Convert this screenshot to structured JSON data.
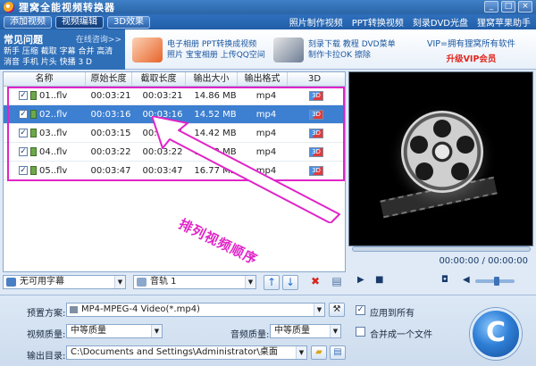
{
  "window": {
    "title": "狸窝全能视频转换器",
    "controls": [
      "_",
      "□",
      "×"
    ]
  },
  "menu": {
    "tabs": [
      "添加视频",
      "视频编辑",
      "3D效果"
    ],
    "active_tab": "视频编辑",
    "links": [
      "照片制作视频",
      "PPT转换视频",
      "刻录DVD光盘",
      "狸窝苹果助手"
    ]
  },
  "faq": {
    "title": "常见问题",
    "online": "在线咨询>>",
    "line1": "新手 压缩 截取 字幕 合并 高清",
    "line2": "消音 手机 片头 快播 3 D"
  },
  "promos": [
    {
      "line1": "电子相册  PPT转换成视频",
      "line2": "照片  宝宝相册  上传QQ空间"
    },
    {
      "line1": "刻录下载  教程  DVD菜单",
      "line2": "制作卡拉OK  擦除"
    }
  ],
  "vip": {
    "line1": "VIP=拥有狸窝所有软件",
    "line2": "升级VIP会员"
  },
  "table": {
    "headers": [
      "名称",
      "原始长度",
      "截取长度",
      "输出大小",
      "输出格式",
      "3D"
    ],
    "rows": [
      {
        "name": "01..flv",
        "orig": "00:03:21",
        "cut": "00:03:21",
        "size": "14.86 MB",
        "format": "mp4",
        "checked": true
      },
      {
        "name": "02..flv",
        "orig": "00:03:16",
        "cut": "00:03:16",
        "size": "14.52 MB",
        "format": "mp4",
        "checked": true
      },
      {
        "name": "03..flv",
        "orig": "00:03:15",
        "cut": "00:03:15",
        "size": "14.42 MB",
        "format": "mp4",
        "checked": true
      },
      {
        "name": "04..flv",
        "orig": "00:03:22",
        "cut": "00:03:22",
        "size": "14.92 MB",
        "format": "mp4",
        "checked": true
      },
      {
        "name": "05..flv",
        "orig": "00:03:47",
        "cut": "00:03:47",
        "size": "16.77 MB",
        "format": "mp4",
        "checked": true
      }
    ],
    "selected_index": 1,
    "annotation": "排列视频顺序"
  },
  "toolbar": {
    "subtitle": "无可用字幕",
    "audio": "音轨 1",
    "up": "↑",
    "down": "↓",
    "delete": "✖",
    "clear": "▤"
  },
  "player": {
    "time": "00:00:00 / 00:00:00",
    "play": "▶",
    "stop": "■",
    "camera": "◘",
    "volume_level": 0.55
  },
  "settings": {
    "preset_label": "预置方案:",
    "preset_value": "MP4-MPEG-4 Video(*.mp4)",
    "apply_all": "应用到所有",
    "apply_all_checked": true,
    "video_quality_label": "视频质量:",
    "video_quality_value": "中等质量",
    "audio_quality_label": "音频质量:",
    "audio_quality_value": "中等质量",
    "merge": "合并成一个文件",
    "merge_checked": false,
    "output_dir_label": "输出目录:",
    "output_dir_value": "C:\\Documents and Settings\\Administrator\\桌面",
    "convert_symbol": "C"
  },
  "colors": {
    "accent": "#2f6fb8",
    "selected_row": "#3d7fd1",
    "annotation": "#e024c8",
    "vip_red": "#e0261d"
  }
}
